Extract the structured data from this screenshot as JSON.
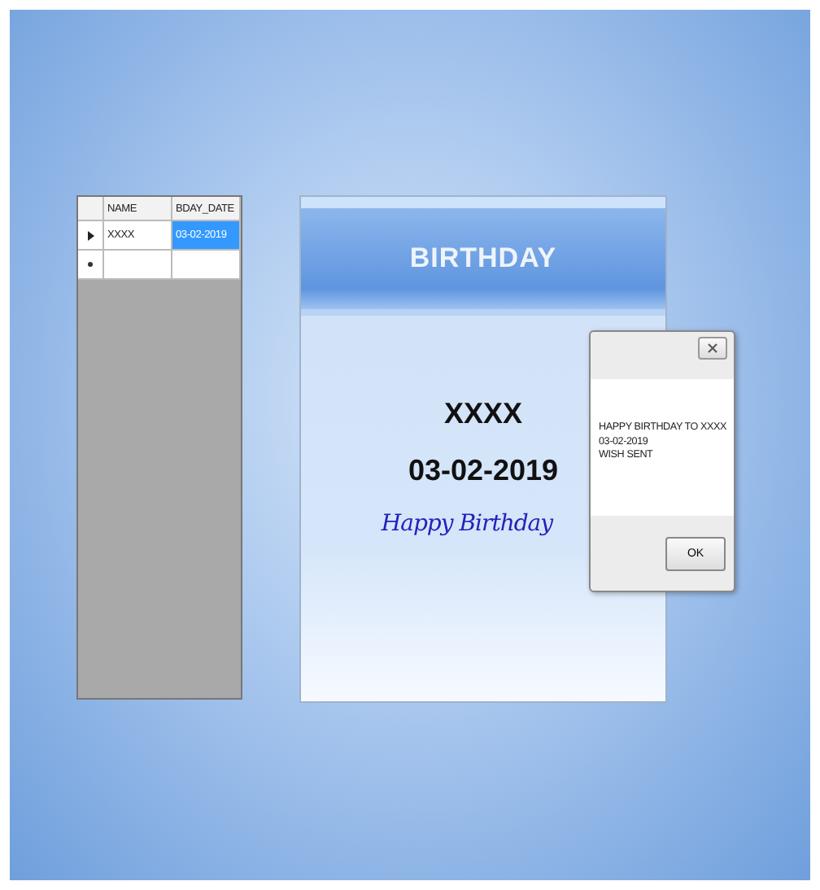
{
  "grid": {
    "columns": [
      "NAME",
      "BDAY_DATE"
    ],
    "rows": [
      {
        "kind": "current",
        "cells": [
          {
            "text": "XXXX",
            "selected": false
          },
          {
            "text": "03-02-2019",
            "selected": true
          }
        ]
      },
      {
        "kind": "new",
        "cells": [
          {
            "text": "",
            "selected": false
          },
          {
            "text": "",
            "selected": false
          }
        ]
      }
    ]
  },
  "card": {
    "title": "BIRTHDAY",
    "name": "XXXX",
    "date": "03-02-2019",
    "greeting": "Happy Birthday"
  },
  "dialog": {
    "message_lines": [
      "HAPPY BIRTHDAY TO XXXX",
      "03-02-2019",
      "WISH SENT"
    ],
    "button": "OK"
  }
}
